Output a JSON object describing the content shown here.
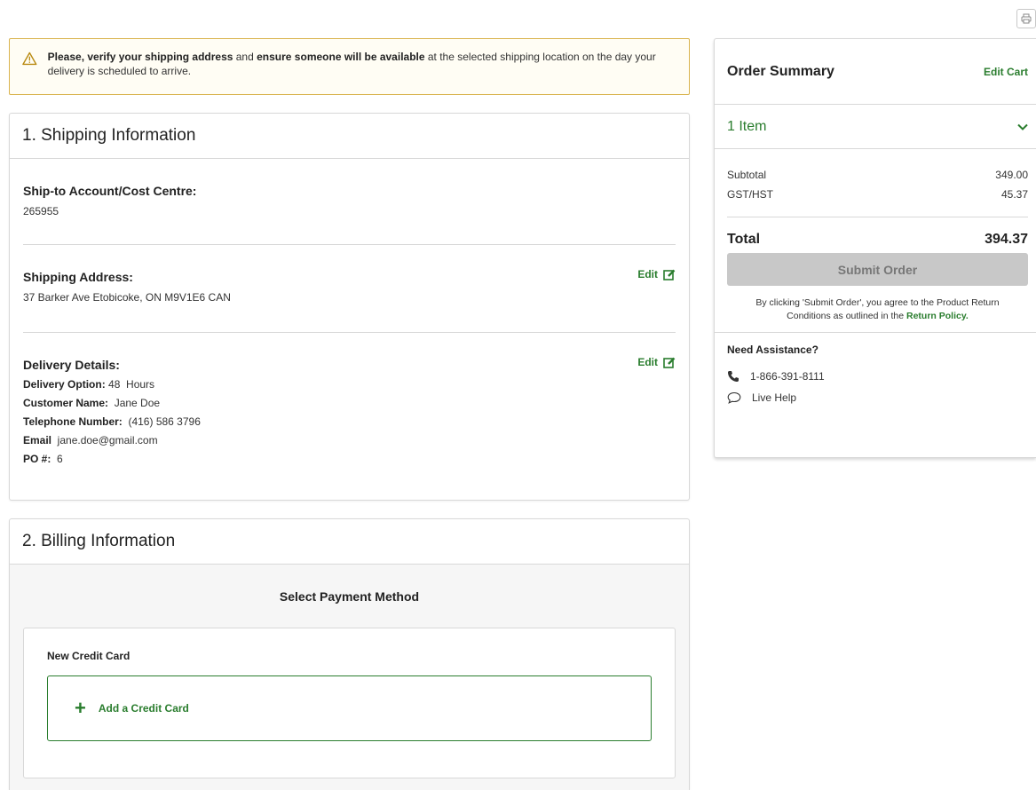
{
  "toolbar": {
    "print_icon": "printer-icon"
  },
  "alert": {
    "icon": "warning-icon",
    "part1": "Please, verify your shipping address",
    "part2": " and ",
    "part3": "ensure someone will be available",
    "part4": " at the selected shipping location on the day your delivery is scheduled to arrive."
  },
  "shipping": {
    "heading": "1. Shipping Information",
    "account_label": "Ship-to Account/Cost Centre:",
    "account_value": "265955",
    "address_label": "Shipping Address:",
    "address_value": "37 Barker Ave Etobicoke, ON M9V1E6 CAN",
    "edit_label": "Edit",
    "delivery_label": "Delivery Details:",
    "delivery": [
      {
        "key": "Delivery Option:",
        "value": " 48  Hours"
      },
      {
        "key": "Customer Name:",
        "value": "  Jane Doe"
      },
      {
        "key": "Telephone Number:",
        "value": "  (416) 586 3796"
      },
      {
        "key": "Email",
        "value": "  jane.doe@gmail.com"
      },
      {
        "key": "PO #:",
        "value": "  6"
      }
    ]
  },
  "billing": {
    "heading": "2. Billing Information",
    "select_payment": "Select Payment Method",
    "new_cc_title": "New Credit Card",
    "add_cc_label": "Add a Credit Card",
    "add_cc_symbol": "+"
  },
  "summary": {
    "title": "Order Summary",
    "edit_cart": "Edit Cart",
    "items_label": "1 Item",
    "subtotal_label": "Subtotal",
    "subtotal_value": "349.00",
    "tax_label": "GST/HST",
    "tax_value": "45.37",
    "total_label": "Total",
    "total_value": "394.37",
    "submit_label": "Submit Order",
    "agree_text": "By clicking 'Submit Order', you agree to the Product Return Conditions as outlined in the ",
    "return_policy": "Return Policy",
    "agree_end": ".",
    "assist_title": "Need Assistance?",
    "phone": "1-866-391-8111",
    "live_help": "Live Help"
  },
  "colors": {
    "accent": "#2a7d2e",
    "alert_border": "#d9b34d",
    "disabled": "#c8c8c8"
  }
}
